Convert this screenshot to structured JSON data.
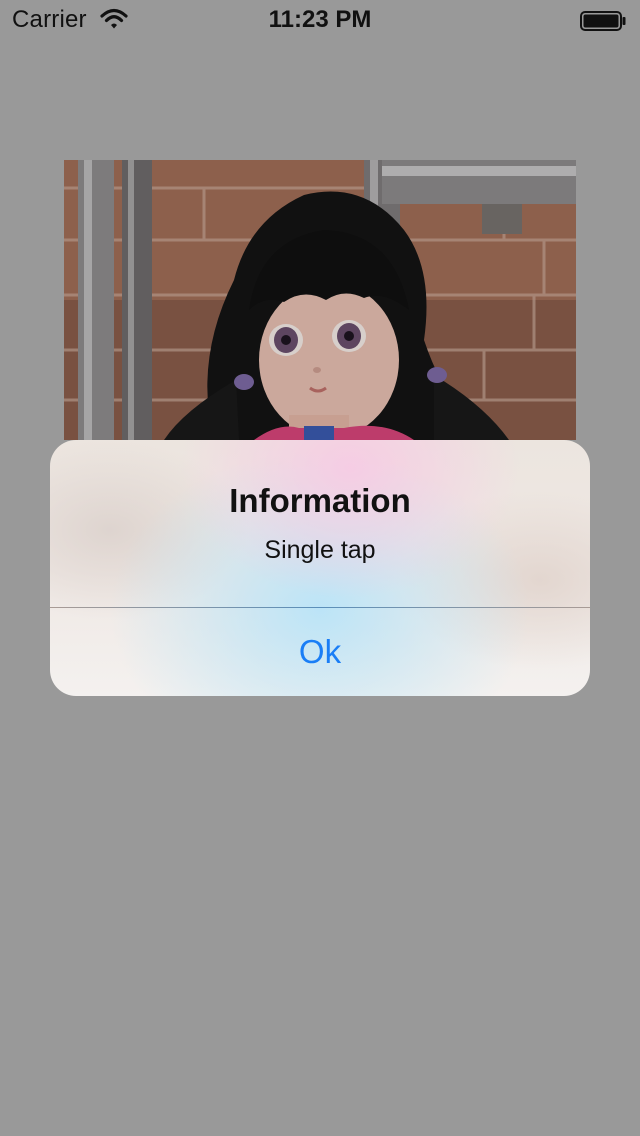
{
  "status_bar": {
    "carrier": "Carrier",
    "time": "11:23 PM",
    "wifi_icon": "wifi-icon",
    "battery_icon": "battery-icon"
  },
  "photo": {
    "subject": "doll-photo"
  },
  "alert": {
    "title": "Information",
    "message": "Single tap",
    "button_label": "Ok",
    "button_color": "#1a7ef6"
  },
  "colors": {
    "background": "#999999",
    "text": "#111111"
  }
}
